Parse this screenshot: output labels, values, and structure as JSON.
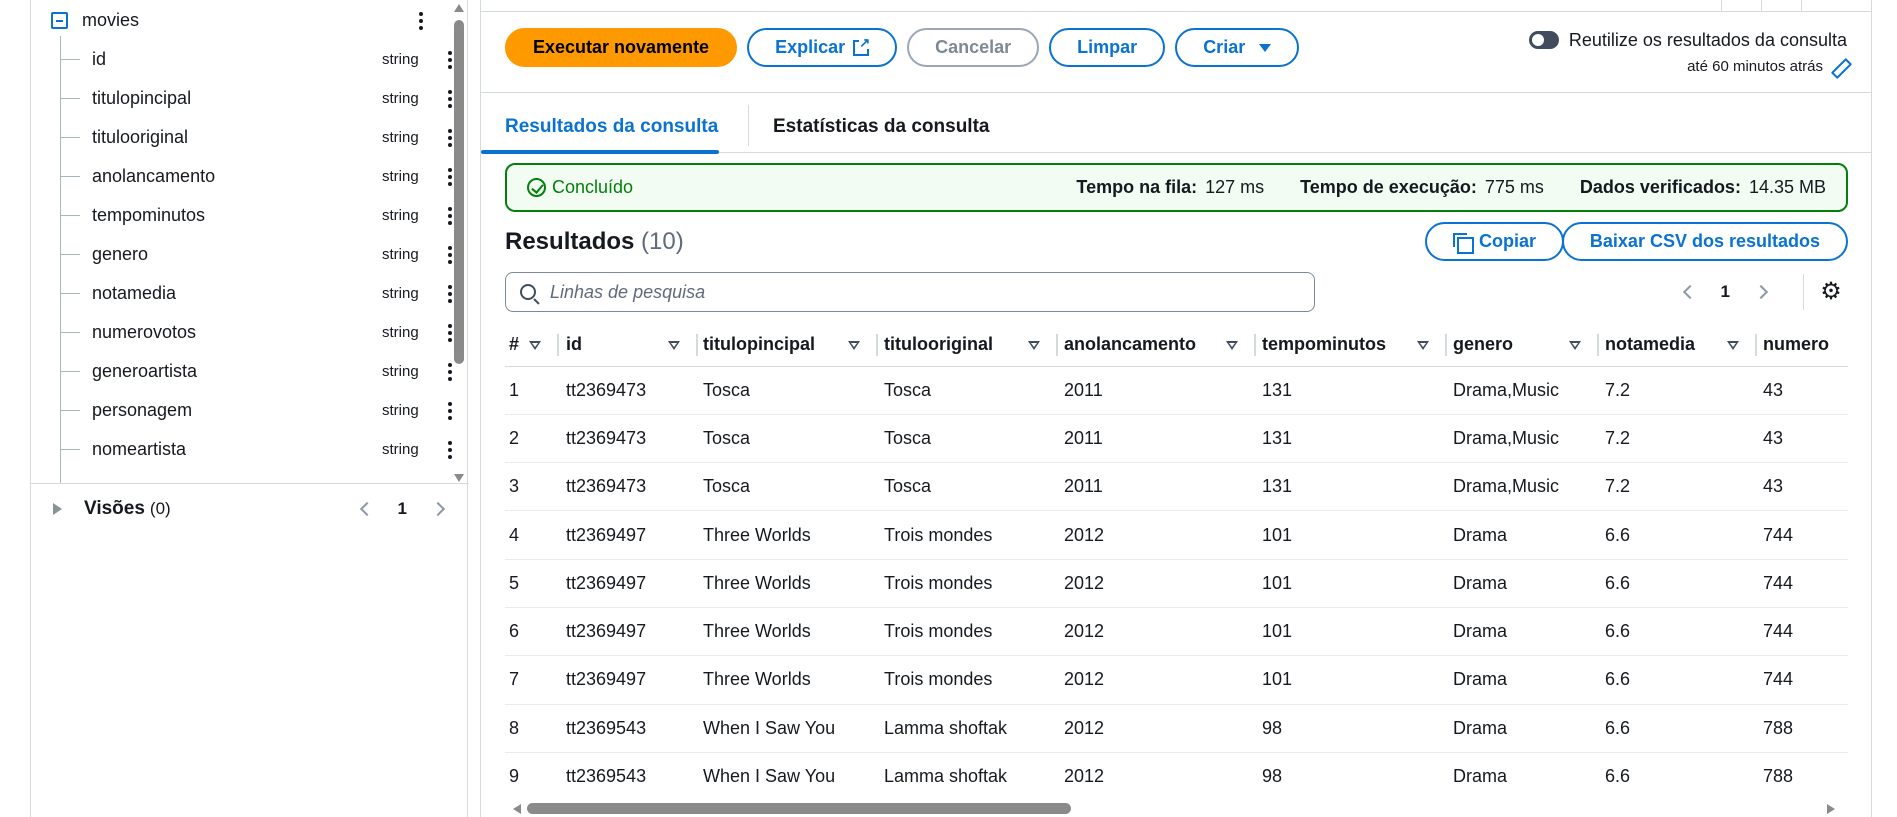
{
  "schema": {
    "table_name": "movies",
    "columns": [
      {
        "name": "id",
        "type": "string"
      },
      {
        "name": "titulopincipal",
        "type": "string"
      },
      {
        "name": "titulooriginal",
        "type": "string"
      },
      {
        "name": "anolancamento",
        "type": "string"
      },
      {
        "name": "tempominutos",
        "type": "string"
      },
      {
        "name": "genero",
        "type": "string"
      },
      {
        "name": "notamedia",
        "type": "string"
      },
      {
        "name": "numerovotos",
        "type": "string"
      },
      {
        "name": "generoartista",
        "type": "string"
      },
      {
        "name": "personagem",
        "type": "string"
      },
      {
        "name": "nomeartista",
        "type": "string"
      }
    ],
    "views": {
      "label": "Visões",
      "count": "(0)",
      "page": "1"
    }
  },
  "toolbar": {
    "run_again": "Executar novamente",
    "explain": "Explicar",
    "cancel": "Cancelar",
    "clear": "Limpar",
    "create": "Criar"
  },
  "reuse": {
    "label": "Reutilize os resultados da consulta",
    "sub": "até 60 minutos atrás"
  },
  "tabs": {
    "results": "Resultados da consulta",
    "stats": "Estatísticas da consulta"
  },
  "status": {
    "text": "Concluído",
    "queue_label": "Tempo na fila:",
    "queue_value": "127 ms",
    "exec_label": "Tempo de execução:",
    "exec_value": "775 ms",
    "scanned_label": "Dados verificados:",
    "scanned_value": "14.35 MB"
  },
  "results": {
    "title": "Resultados",
    "count": "(10)",
    "copy": "Copiar",
    "download_csv": "Baixar CSV dos resultados",
    "search_placeholder": "Linhas de pesquisa",
    "page": "1",
    "headers": [
      "#",
      "id",
      "titulopincipal",
      "titulooriginal",
      "anolancamento",
      "tempominutos",
      "genero",
      "notamedia",
      "numero"
    ],
    "rows": [
      [
        "1",
        "tt2369473",
        "Tosca",
        "Tosca",
        "2011",
        "131",
        "Drama,Music",
        "7.2",
        "43"
      ],
      [
        "2",
        "tt2369473",
        "Tosca",
        "Tosca",
        "2011",
        "131",
        "Drama,Music",
        "7.2",
        "43"
      ],
      [
        "3",
        "tt2369473",
        "Tosca",
        "Tosca",
        "2011",
        "131",
        "Drama,Music",
        "7.2",
        "43"
      ],
      [
        "4",
        "tt2369497",
        "Three Worlds",
        "Trois mondes",
        "2012",
        "101",
        "Drama",
        "6.6",
        "744"
      ],
      [
        "5",
        "tt2369497",
        "Three Worlds",
        "Trois mondes",
        "2012",
        "101",
        "Drama",
        "6.6",
        "744"
      ],
      [
        "6",
        "tt2369497",
        "Three Worlds",
        "Trois mondes",
        "2012",
        "101",
        "Drama",
        "6.6",
        "744"
      ],
      [
        "7",
        "tt2369497",
        "Three Worlds",
        "Trois mondes",
        "2012",
        "101",
        "Drama",
        "6.6",
        "744"
      ],
      [
        "8",
        "tt2369543",
        "When I Saw You",
        "Lamma shoftak",
        "2012",
        "98",
        "Drama",
        "6.6",
        "788"
      ],
      [
        "9",
        "tt2369543",
        "When I Saw You",
        "Lamma shoftak",
        "2012",
        "98",
        "Drama",
        "6.6",
        "788"
      ]
    ]
  }
}
